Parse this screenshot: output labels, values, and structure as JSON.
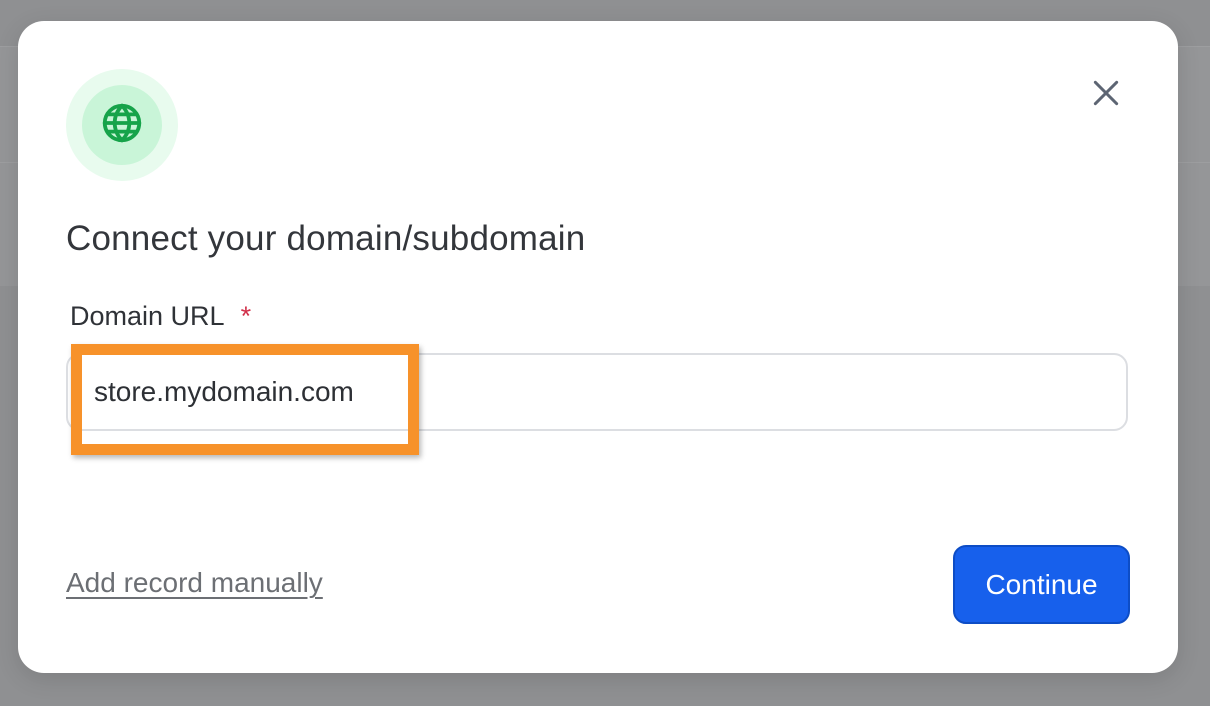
{
  "modal": {
    "icon": "globe-icon",
    "title": "Connect your domain/subdomain",
    "close_icon": "close-icon",
    "field": {
      "label": "Domain URL",
      "required_marker": "*",
      "value": "store.mydomain.com"
    },
    "manual_link_label": "Add record manually",
    "continue_label": "Continue"
  },
  "colors": {
    "overlay": "#8f9092",
    "icon_green": "#16a34a",
    "icon_badge_outer": "#e8fbee",
    "icon_badge_inner": "#c9f5d8",
    "primary_button": "#1760ec",
    "required_star": "#d1304a",
    "highlight": "#f7922a"
  }
}
